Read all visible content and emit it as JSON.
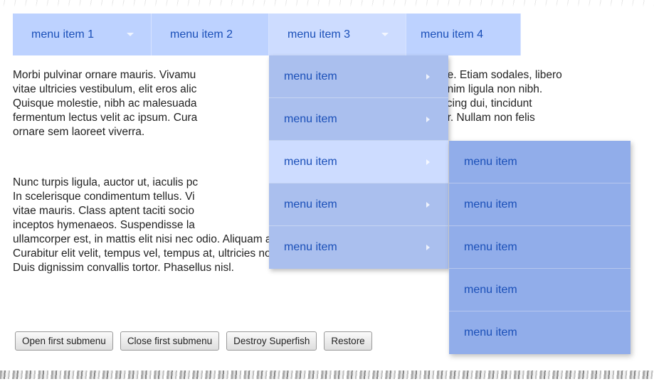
{
  "menu": {
    "items": [
      {
        "label": "menu item 1"
      },
      {
        "label": "menu item 2"
      },
      {
        "label": "menu item 3"
      },
      {
        "label": "menu item 4"
      }
    ]
  },
  "dropdown": {
    "items": [
      {
        "label": "menu item"
      },
      {
        "label": "menu item"
      },
      {
        "label": "menu item"
      },
      {
        "label": "menu item"
      },
      {
        "label": "menu item"
      }
    ]
  },
  "submenu": {
    "items": [
      {
        "label": "menu item"
      },
      {
        "label": "menu item"
      },
      {
        "label": "menu item"
      },
      {
        "label": "menu item"
      },
      {
        "label": "menu item"
      }
    ]
  },
  "content": {
    "paragraph1": [
      "Morbi pulvinar ornare mauris. Vivamu",
      "vitae ultricies vestibulum, elit eros alic",
      "Quisque molestie, nibh ac malesuada",
      "fermentum lectus velit ac ipsum. Cura",
      "ornare sem laoreet viverra."
    ],
    "paragraph1_right": [
      "de. Etiam sodales, libero",
      "enim ligula non nibh.",
      "scing dui, tincidunt",
      "or. Nullam non felis"
    ],
    "paragraph2": [
      "Nunc turpis ligula, auctor ut, iaculis pc",
      "In scelerisque condimentum tellus. Vi",
      "vitae mauris. Class aptent taciti socio",
      "inceptos hymenaeos. Suspendisse la",
      "ullamcorper est, in mattis elit nisi nec odio. Aliquam a sem sit am",
      "Curabitur elit velit, tempus vel, tempus at, ultricies non, arcu. Duis",
      "Duis dignissim convallis tortor. Phasellus nisl."
    ]
  },
  "buttons": {
    "open_first": "Open first submenu",
    "close_first": "Close first submenu",
    "destroy": "Destroy Superfish",
    "restore": "Restore"
  },
  "colors": {
    "menu_bg": "#bdd2ff",
    "menu_active_bg": "#cddcff",
    "dropdown_bg": "#aabfee",
    "submenu_bg": "#91adea",
    "menu_text": "#1a4fb8"
  }
}
